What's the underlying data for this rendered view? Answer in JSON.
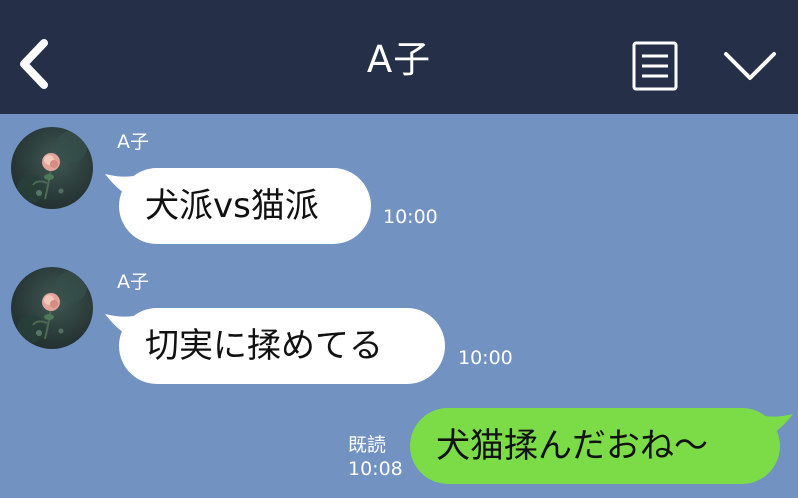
{
  "header": {
    "title": "A子",
    "back_icon": "chevron-left-icon",
    "menu_icon": "document-list-icon",
    "expand_icon": "chevron-down-icon"
  },
  "colors": {
    "header_bg": "#253048",
    "chat_bg": "#7292c2",
    "incoming_bubble": "#ffffff",
    "outgoing_bubble": "#7bdc47"
  },
  "messages": [
    {
      "direction": "incoming",
      "sender": "A子",
      "text": "犬派vs猫派",
      "time": "10:00"
    },
    {
      "direction": "incoming",
      "sender": "A子",
      "text": "切実に揉めてる",
      "time": "10:00"
    },
    {
      "direction": "outgoing",
      "text": "犬猫揉んだおね〜",
      "read_label": "既読",
      "time": "10:08"
    }
  ]
}
